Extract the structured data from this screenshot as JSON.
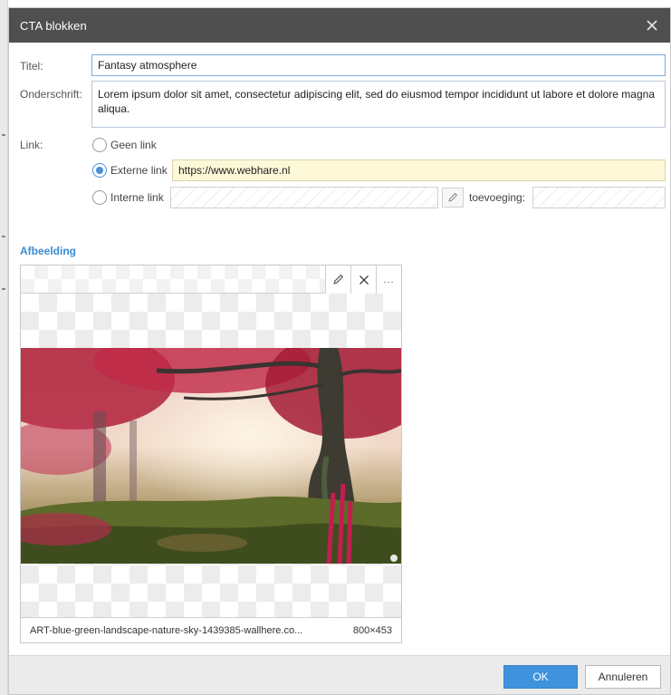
{
  "dialog": {
    "title": "CTA blokken",
    "close_icon": "close-icon"
  },
  "form": {
    "title_label": "Titel:",
    "title_value": "Fantasy atmosphere",
    "caption_label": "Onderschrift:",
    "caption_value": "Lorem ipsum dolor sit amet, consectetur adipiscing elit, sed do eiusmod tempor incididunt ut labore et dolore magna aliqua.",
    "link_label": "Link:",
    "link_options": [
      {
        "label": "Geen link",
        "selected": false
      },
      {
        "label": "Externe link",
        "selected": true
      },
      {
        "label": "Interne link",
        "selected": false
      }
    ],
    "external_url": "https://www.webhare.nl",
    "internal_link_value": "",
    "addition_label": "toevoeging:",
    "addition_value": ""
  },
  "image_section": {
    "heading": "Afbeelding",
    "toolbar_icons": [
      "pencil-icon",
      "close-icon",
      "more-icon"
    ],
    "more_label": "...",
    "filename": "ART-blue-green-landscape-nature-sky-1439385-wallhere.co...",
    "dimensions": "800×453"
  },
  "footer": {
    "ok_label": "OK",
    "cancel_label": "Annuleren"
  },
  "colors": {
    "titlebar": "#4f4f4f",
    "accent": "#3f93dc",
    "url_field_bg": "#fdf9d8"
  }
}
